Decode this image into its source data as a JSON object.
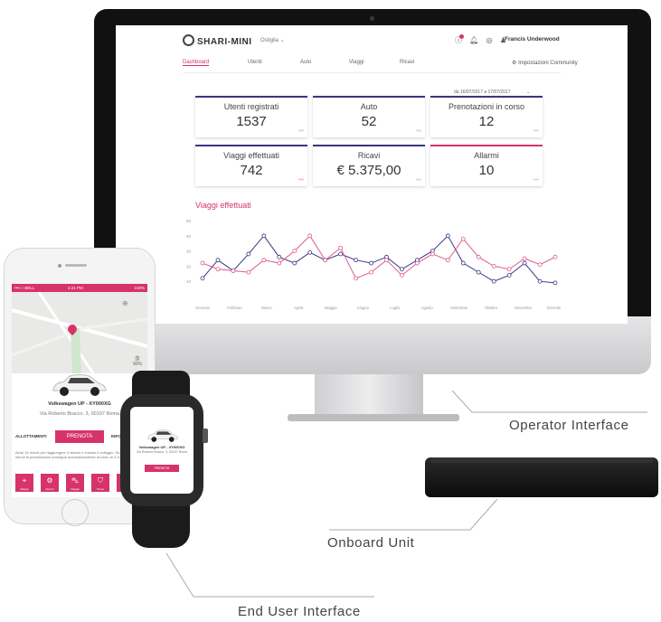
{
  "labels": {
    "operator": "Operator Interface",
    "onboard": "Onboard Unit",
    "enduser": "End User Interface"
  },
  "dashboard": {
    "logo": "SHARI-MINI",
    "city": "Ostiglia",
    "user": "Francis Underwood",
    "nav": [
      "Dashboard",
      "Utenti",
      "Auto",
      "Viaggi",
      "Ricavi"
    ],
    "community": "Impostazioni Community",
    "date_range": "da 16/07/2017 a 17/07/2017",
    "cards": [
      {
        "label": "Utenti registrati",
        "value": "1537",
        "accent": "#3a3580"
      },
      {
        "label": "Auto",
        "value": "52",
        "accent": "#3a3580"
      },
      {
        "label": "Prenotazioni in corso",
        "value": "12",
        "accent": "#3a3580"
      },
      {
        "label": "Viaggi effettuati",
        "value": "742",
        "accent": "#3a3580"
      },
      {
        "label": "Ricavi",
        "value": "€ 5.375,00",
        "accent": "#3a3580"
      },
      {
        "label": "Allarmi",
        "value": "10",
        "accent": "#d6336c"
      }
    ],
    "chart_title": "Viaggi effettuati"
  },
  "chart_data": {
    "type": "line",
    "title": "Viaggi effettuati",
    "categories": [
      "Gennaio",
      "Febbraio",
      "Marzo",
      "Aprile",
      "Maggio",
      "Giugno",
      "Luglio",
      "Agosto",
      "Settembre",
      "Ottobre",
      "Novembre",
      "Dicembre"
    ],
    "ylim": [
      0,
      50
    ],
    "yticks": [
      10,
      20,
      30,
      40,
      50
    ],
    "series": [
      {
        "color": "#3a3580",
        "values": [
          12,
          24,
          17,
          28,
          40,
          26,
          22,
          29,
          24,
          28,
          24,
          22,
          26,
          18,
          24,
          30,
          40,
          22,
          16,
          10,
          14,
          22,
          10,
          9
        ]
      },
      {
        "color": "#e05a8c",
        "values": [
          22,
          18,
          17,
          16,
          24,
          22,
          30,
          40,
          24,
          32,
          12,
          16,
          24,
          14,
          22,
          28,
          24,
          38,
          26,
          20,
          18,
          25,
          21,
          26
        ]
      }
    ]
  },
  "phone": {
    "status_left": "•••○○ BELL",
    "status_time": "4:21 PM",
    "status_right": "100%",
    "fuel": "90%",
    "car_name": "Volkswagen UP - XY000XG",
    "car_address": "Via Roberto Bracco, 3, 00197 Roma",
    "tab_left": "ALLOTTAMENTI",
    "book_button": "PRENOTA",
    "tab_right": "INFORMAZIONI",
    "description": "Avrai 15 minuti per raggiungere il veicolo e iniziare il noleggio. Scaduti i 15 minuti la prenotazione prosegue automaticamente al costo di 0,10€ al minuto",
    "tiles": [
      "Mappa",
      "Servizi",
      "Viaggio",
      "Premi",
      "Altro"
    ]
  },
  "watch": {
    "car_name": "Volkswagen UP - XY000XG",
    "car_address": "Via Roberto Bracco, 3, 00197 Roma",
    "book_button": "PRENOTA"
  }
}
